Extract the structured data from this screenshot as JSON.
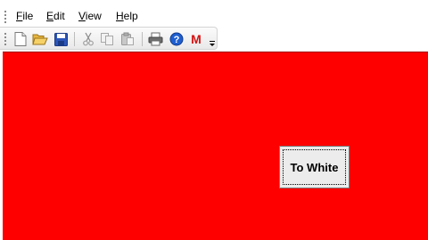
{
  "menu": {
    "file": {
      "mnemonic": "F",
      "rest": "ile"
    },
    "edit": {
      "mnemonic": "E",
      "rest": "dit"
    },
    "view": {
      "mnemonic": "V",
      "rest": "iew"
    },
    "help": {
      "mnemonic": "H",
      "rest": "elp"
    }
  },
  "toolbar": {
    "icons": [
      "new-document-icon",
      "open-folder-icon",
      "save-icon",
      "cut-icon",
      "copy-icon",
      "paste-icon",
      "print-icon",
      "help-icon",
      "m-logo-icon"
    ],
    "m_letter": "M"
  },
  "canvas": {
    "background_color": "#ff0000"
  },
  "action_button": {
    "label": "To White"
  }
}
